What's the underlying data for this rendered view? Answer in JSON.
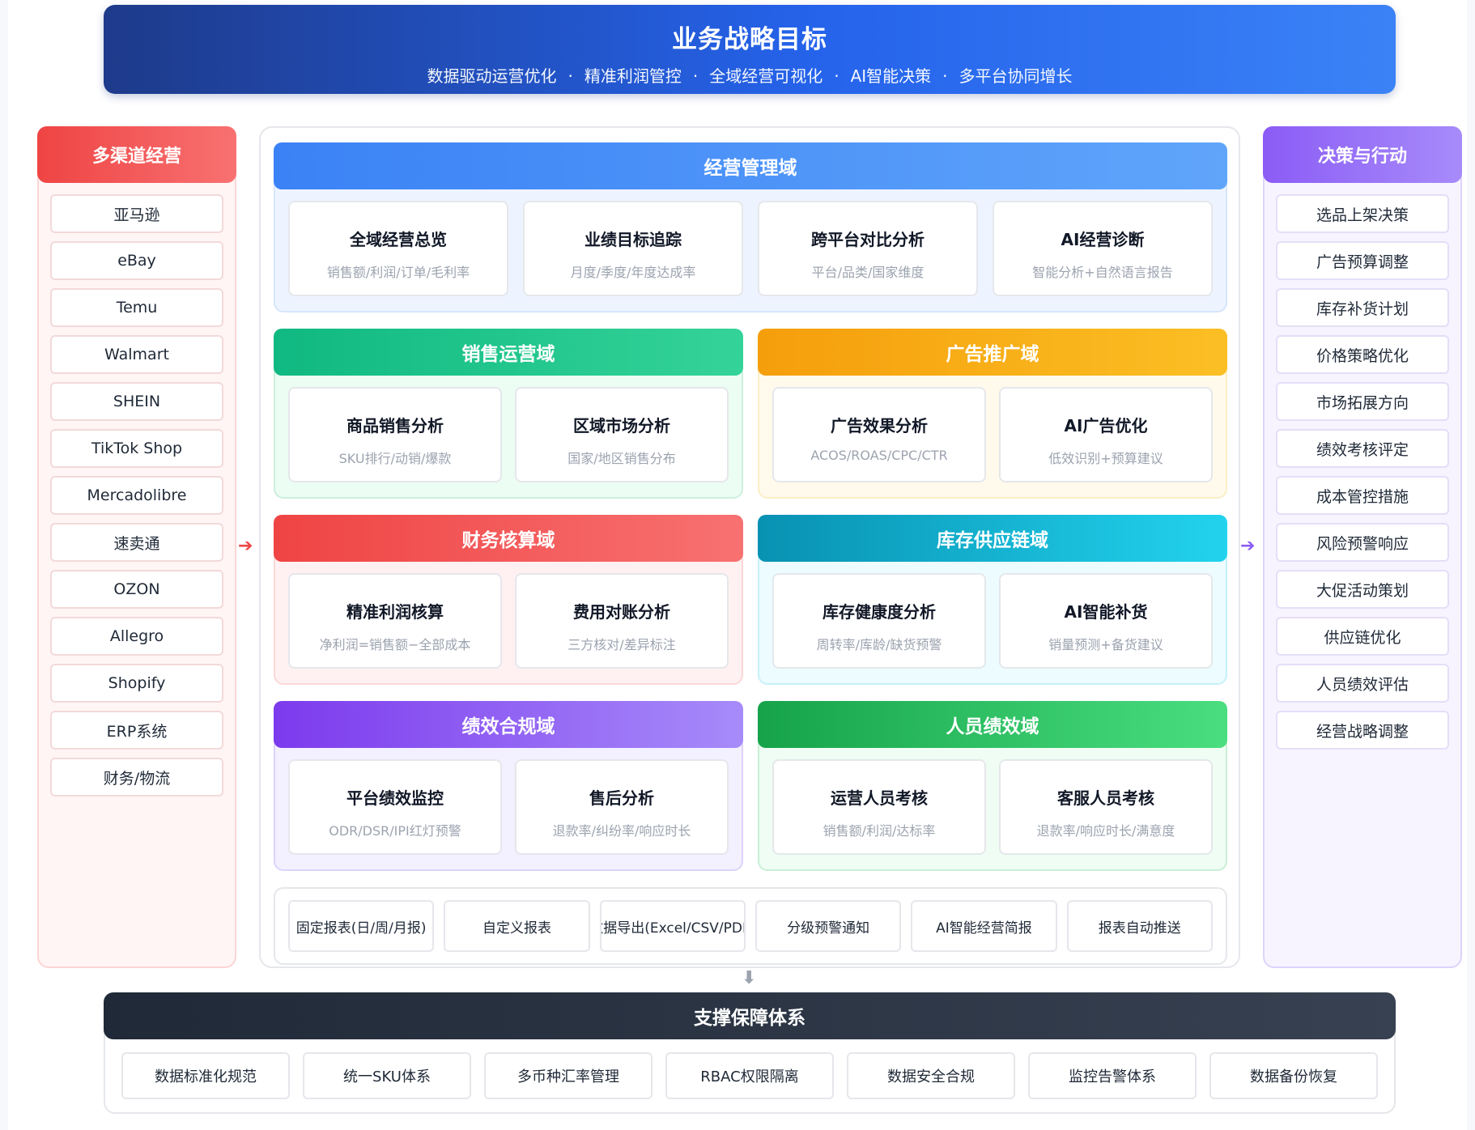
{
  "banner": {
    "title": "业务战略目标",
    "goals": [
      "数据驱动运营优化",
      "精准利润管控",
      "全域经营可视化",
      "AI智能决策",
      "多平台协同增长"
    ],
    "separator": "·"
  },
  "left": {
    "title": "多渠道经营",
    "items": [
      "亚马逊",
      "eBay",
      "Temu",
      "Walmart",
      "SHEIN",
      "TikTok Shop",
      "Mercadolibre",
      "速卖通",
      "OZON",
      "Allegro",
      "Shopify",
      "ERP系统",
      "财务/物流"
    ]
  },
  "right": {
    "title": "决策与行动",
    "items": [
      "选品上架决策",
      "广告预算调整",
      "库存补货计划",
      "价格策略优化",
      "市场拓展方向",
      "绩效考核评定",
      "成本管控措施",
      "风险预警响应",
      "大促活动策划",
      "供应链优化",
      "人员绩效评估",
      "经营战略调整"
    ]
  },
  "arrows": {
    "right_arrow": "➔",
    "down_arrow": "⬇"
  },
  "domains": {
    "mgmt": {
      "title": "经营管理域",
      "cards": [
        {
          "title": "全域经营总览",
          "sub": "销售额/利润/订单/毛利率"
        },
        {
          "title": "业绩目标追踪",
          "sub": "月度/季度/年度达成率"
        },
        {
          "title": "跨平台对比分析",
          "sub": "平台/品类/国家维度"
        },
        {
          "title": "AI经营诊断",
          "sub": "智能分析+自然语言报告"
        }
      ]
    },
    "sales": {
      "title": "销售运营域",
      "cards": [
        {
          "title": "商品销售分析",
          "sub": "SKU排行/动销/爆款"
        },
        {
          "title": "区域市场分析",
          "sub": "国家/地区销售分布"
        }
      ]
    },
    "ads": {
      "title": "广告推广域",
      "cards": [
        {
          "title": "广告效果分析",
          "sub": "ACOS/ROAS/CPC/CTR"
        },
        {
          "title": "AI广告优化",
          "sub": "低效识别+预算建议"
        }
      ]
    },
    "fin": {
      "title": "财务核算域",
      "cards": [
        {
          "title": "精准利润核算",
          "sub": "净利润=销售额−全部成本"
        },
        {
          "title": "费用对账分析",
          "sub": "三方核对/差异标注"
        }
      ]
    },
    "inv": {
      "title": "库存供应链域",
      "cards": [
        {
          "title": "库存健康度分析",
          "sub": "周转率/库龄/缺货预警"
        },
        {
          "title": "AI智能补货",
          "sub": "销量预测+备货建议"
        }
      ]
    },
    "perf": {
      "title": "绩效合规域",
      "cards": [
        {
          "title": "平台绩效监控",
          "sub": "ODR/DSR/IPI红灯预警"
        },
        {
          "title": "售后分析",
          "sub": "退款率/纠纷率/响应时长"
        }
      ]
    },
    "staff": {
      "title": "人员绩效域",
      "cards": [
        {
          "title": "运营人员考核",
          "sub": "销售额/利润/达标率"
        },
        {
          "title": "客服人员考核",
          "sub": "退款率/响应时长/满意度"
        }
      ]
    }
  },
  "reports": [
    "固定报表(日/周/月报)",
    "自定义报表",
    "数据导出(Excel/CSV/PDF)",
    "分级预警通知",
    "AI智能经营简报",
    "报表自动推送"
  ],
  "support": {
    "title": "支撑保障体系",
    "items": [
      "数据标准化规范",
      "统一SKU体系",
      "多币种汇率管理",
      "RBAC权限隔离",
      "数据安全合规",
      "监控告警体系",
      "数据备份恢复"
    ]
  }
}
